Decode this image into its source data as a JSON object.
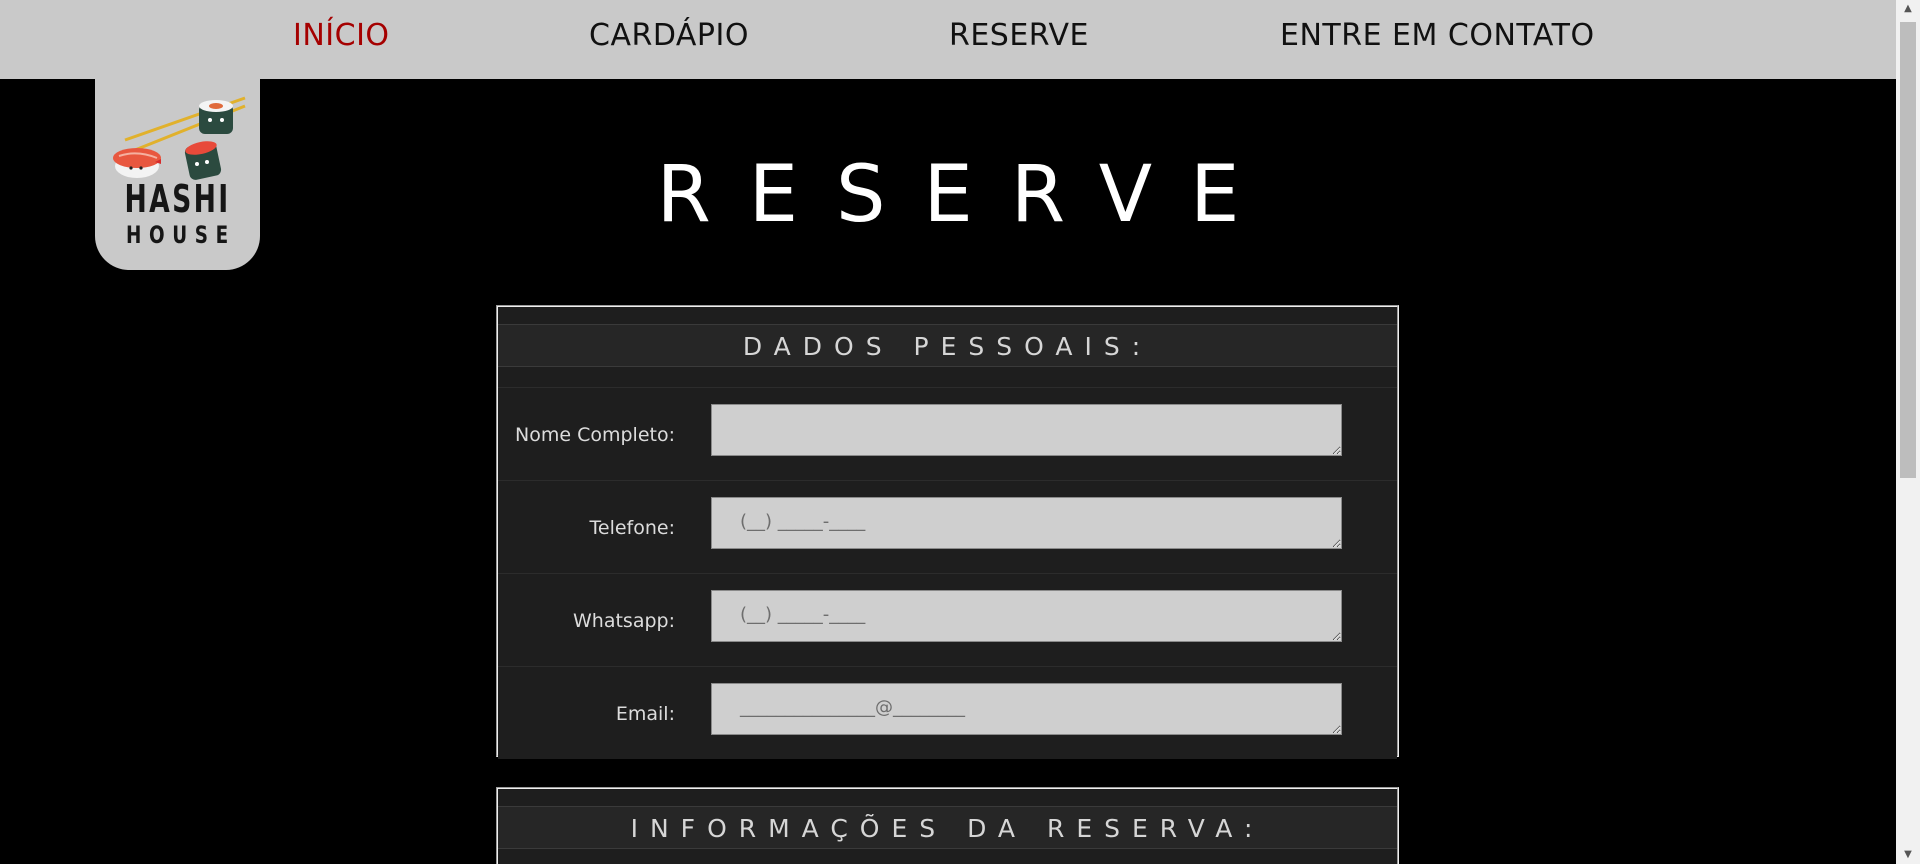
{
  "nav": {
    "items": [
      {
        "label": "INÍCIO",
        "active": true
      },
      {
        "label": "CARDÁPIO",
        "active": false
      },
      {
        "label": "RESERVE",
        "active": false
      },
      {
        "label": "ENTRE EM CONTATO",
        "active": false
      }
    ],
    "active_color": "#a50000"
  },
  "logo": {
    "line1": "HASHI",
    "line2": "HOUSE"
  },
  "page": {
    "title": "RESERVE"
  },
  "personal": {
    "legend": "DADOS PESSOAIS:",
    "fields": [
      {
        "label": "Nome Completo:",
        "placeholder": ""
      },
      {
        "label": "Telefone:",
        "placeholder": "(__) _____-____"
      },
      {
        "label": "Whatsapp:",
        "placeholder": "(__) _____-____"
      },
      {
        "label": "Email:",
        "placeholder": "_______________@________"
      }
    ]
  },
  "booking": {
    "legend": "INFORMAÇÕES DA RESERVA:"
  },
  "colors": {
    "nav_bg": "#c9c9c9",
    "page_bg": "#000000",
    "panel_bg": "#1e1e1e",
    "field_bg": "#cfcfcf"
  }
}
